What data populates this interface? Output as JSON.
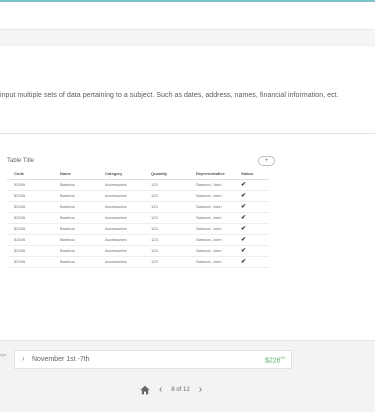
{
  "description": "input multiple sets of data pertaining to a subject. Such as dates, address, names, financial information, ect.",
  "table": {
    "title": "Table Title",
    "add_label": "+",
    "columns": [
      "Code",
      "Name",
      "Category",
      "Quantity",
      "Representative",
      "Status"
    ],
    "rows": [
      [
        "52045",
        "Bamboo",
        "Accessories",
        "123",
        "Samson, John",
        "✔"
      ],
      [
        "52045",
        "Bamboo",
        "Accessories",
        "123",
        "Samson, John",
        "✔"
      ],
      [
        "52045",
        "Bamboo",
        "Accessories",
        "123",
        "Samson, John",
        "✔"
      ],
      [
        "52045",
        "Bamboo",
        "Accessories",
        "123",
        "Samson, John",
        "✔"
      ],
      [
        "52045",
        "Bamboo",
        "Accessories",
        "123",
        "Samson, John",
        "✔"
      ],
      [
        "52045",
        "Bamboo",
        "Accessories",
        "123",
        "Samson, John",
        "✔"
      ],
      [
        "52045",
        "Bamboo",
        "Accessories",
        "123",
        "Samson, John",
        "✔"
      ],
      [
        "52045",
        "Bamboo",
        "Accessories",
        "123",
        "Samson, John",
        "✔"
      ]
    ]
  },
  "bottom": {
    "side_label": "ays",
    "date_range": "November 1st -7th",
    "amount_main": "$226",
    "amount_cents": "00",
    "amount_color": "#5fae5f"
  },
  "pager": {
    "text": "8 of 12",
    "icons": [
      "home-icon",
      "chevron-left-icon",
      "chevron-right-icon"
    ]
  }
}
